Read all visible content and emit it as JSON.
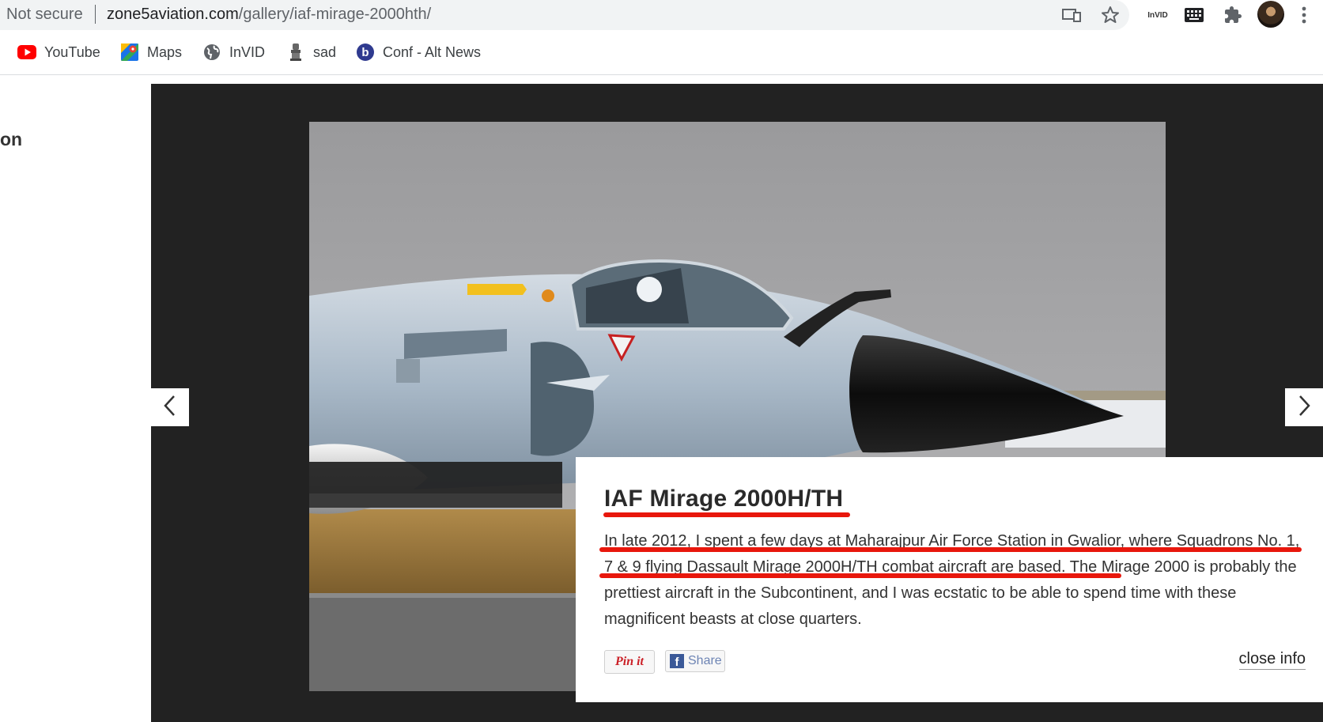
{
  "browser": {
    "security_label": "Not secure",
    "url_host": "zone5aviation.com",
    "url_path": "/gallery/iaf-mirage-2000hth/",
    "toolbar_icons": [
      "cast-icon",
      "star-icon",
      "invid-extension-icon",
      "keyboard-icon",
      "extensions-puzzle-icon",
      "profile-avatar",
      "menu-kebab-icon"
    ],
    "invid_badge": "InVID"
  },
  "bookmarks": [
    {
      "label": "YouTube",
      "icon": "youtube-icon"
    },
    {
      "label": "Maps",
      "icon": "maps-icon"
    },
    {
      "label": "InVID",
      "icon": "globe-icon"
    },
    {
      "label": "sad",
      "icon": "emblem-icon"
    },
    {
      "label": "Conf - Alt News",
      "icon": "b-logo-icon"
    }
  ],
  "page": {
    "left_heading_fragment": "on"
  },
  "gallery": {
    "prev_icon": "chevron-left-icon",
    "next_icon": "chevron-right-icon",
    "info": {
      "title": "IAF Mirage 2000H/TH",
      "description": "In late 2012, I spent a few days at Maharajpur Air Force Station in Gwalior, where Squadrons No. 1, 7 & 9 flying Dassault Mirage 2000H/TH combat aircraft are based. The Mirage 2000 is probably the prettiest aircraft in the Subcontinent, and I was ecstatic to be able to spend time with these magnificent beasts at close quarters.",
      "pin_label": "Pin it",
      "share_label": "Share",
      "close_label": "close info"
    }
  },
  "colors": {
    "gallery_background": "#222222",
    "annotation_red": "#e8170c"
  }
}
